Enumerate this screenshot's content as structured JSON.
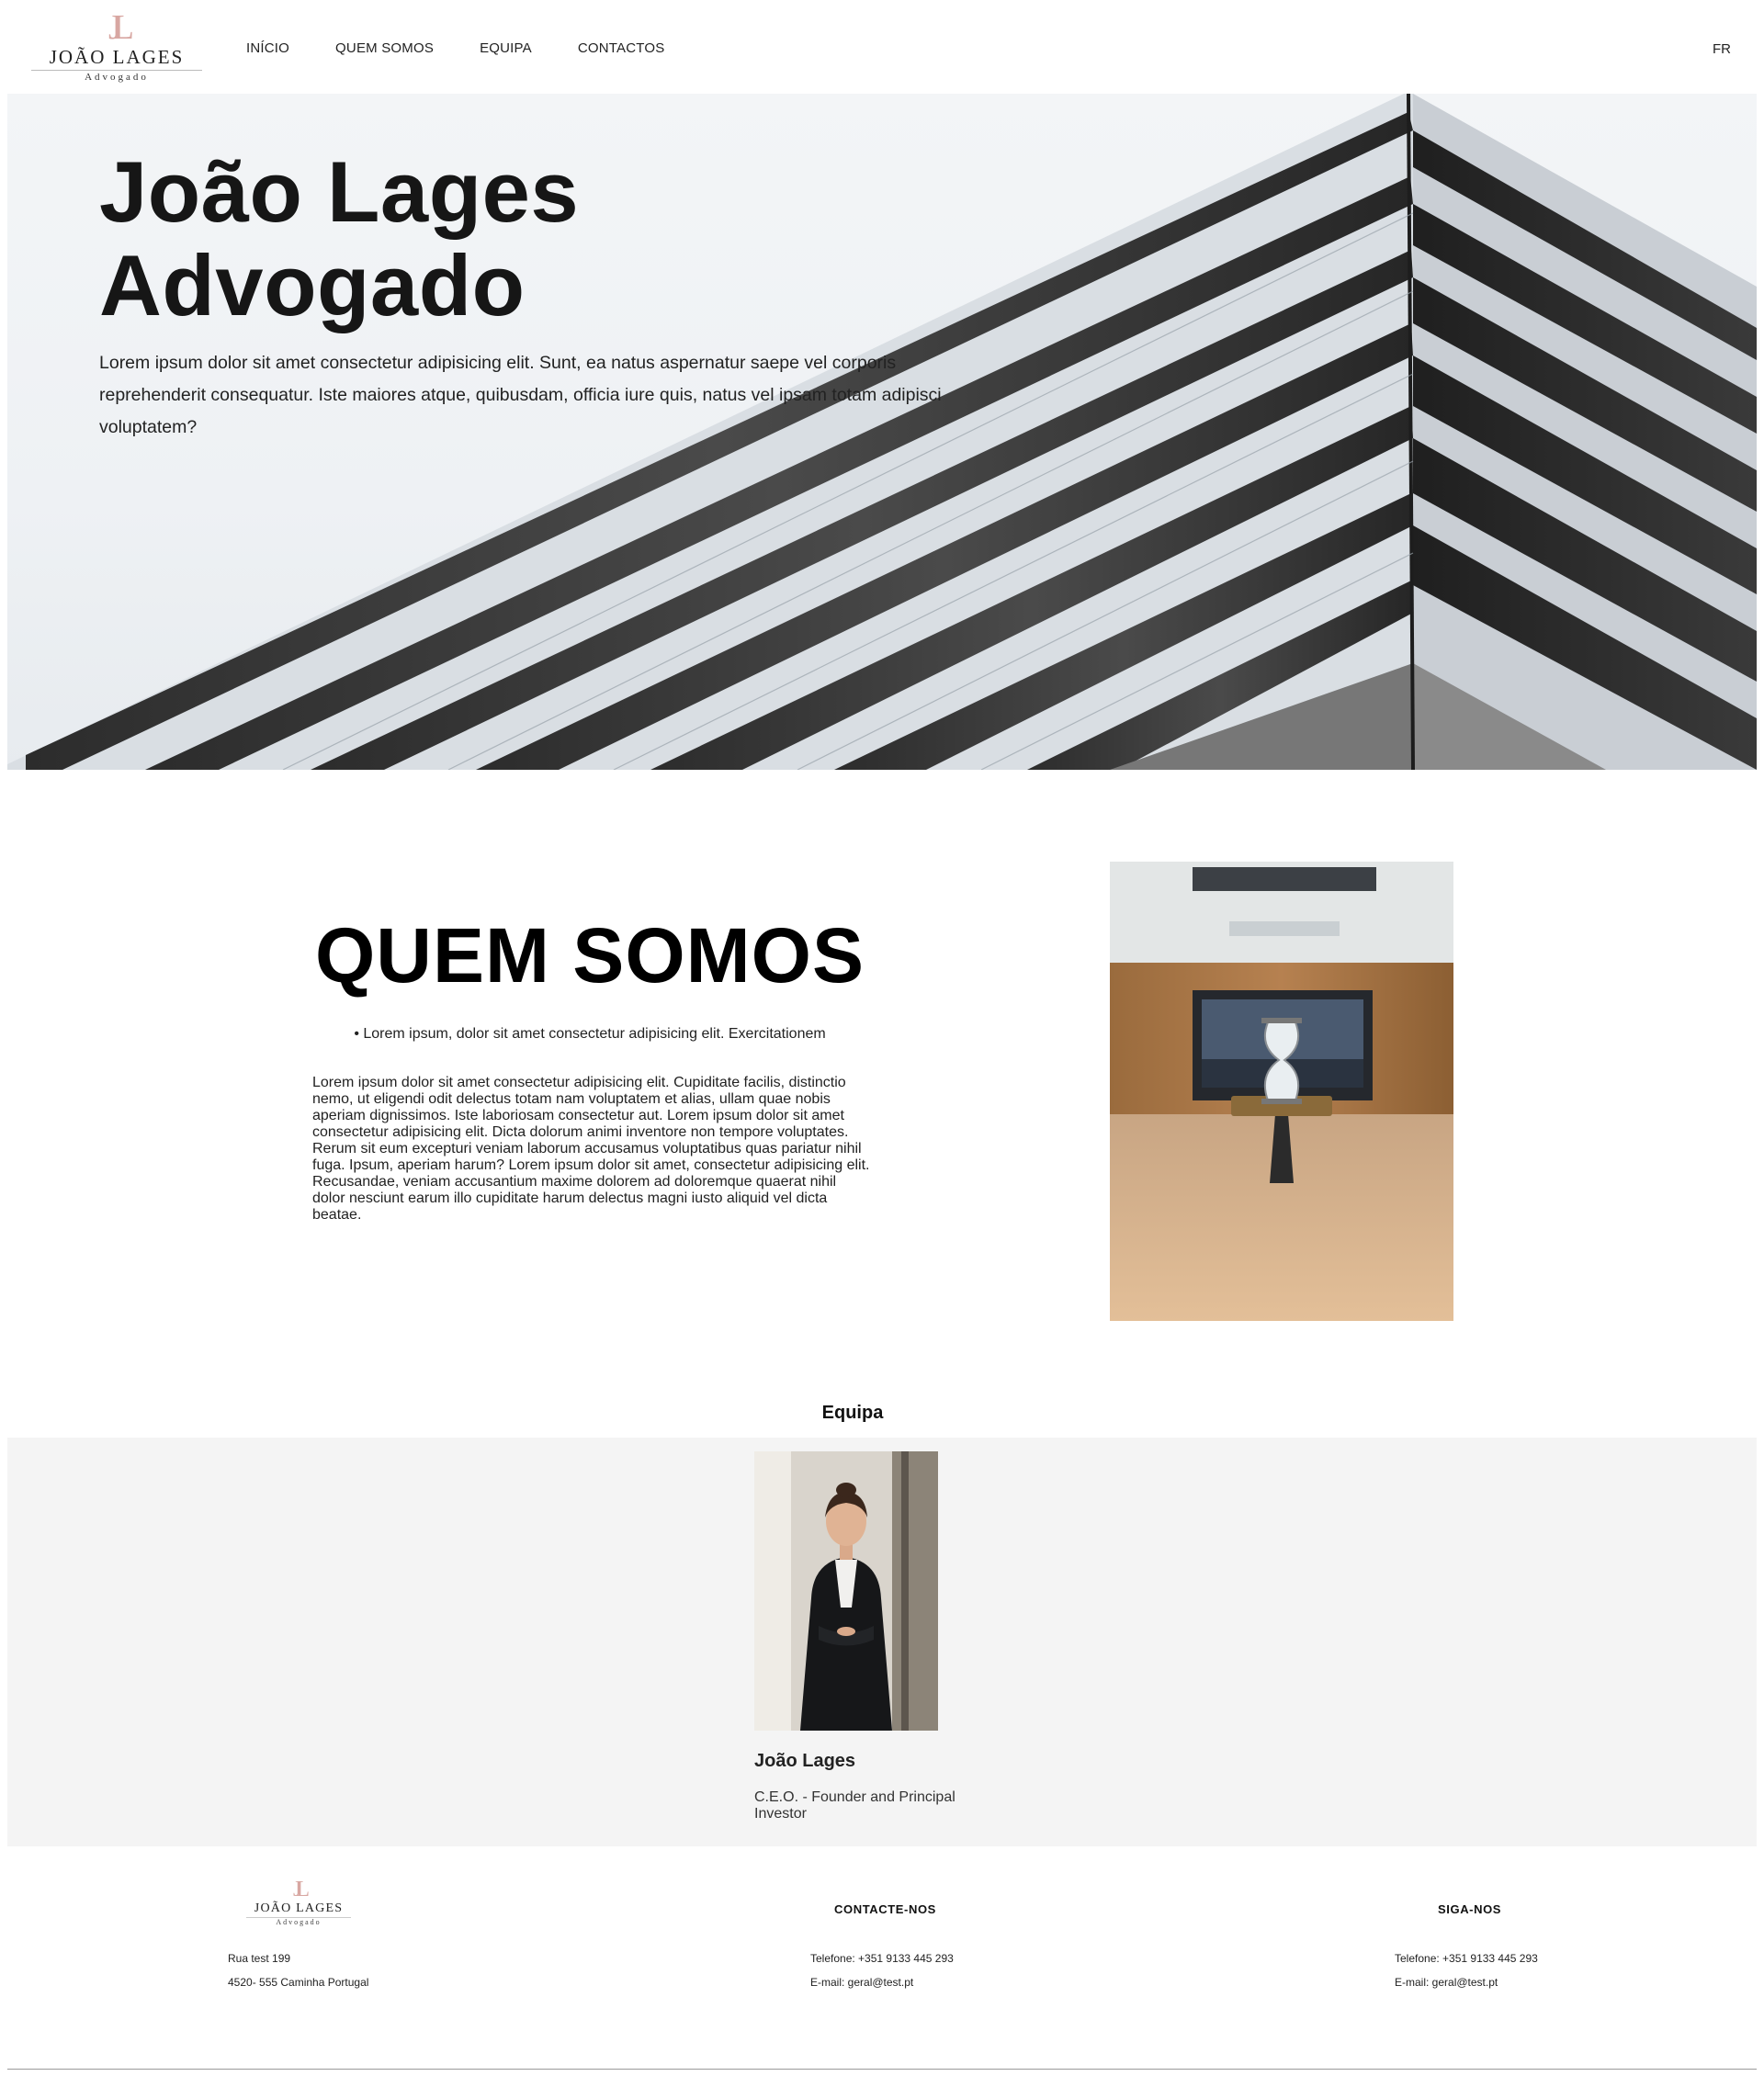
{
  "header": {
    "logo": {
      "monogram": "JL",
      "name": "JOÃO LAGES",
      "subtitle": "Advogado"
    },
    "nav": [
      "INÍCIO",
      "QUEM SOMOS",
      "EQUIPA",
      "CONTACTOS"
    ],
    "language": "FR"
  },
  "hero": {
    "title_line1": "João Lages",
    "title_line2": "Advogado",
    "body": "Lorem ipsum dolor sit amet consectetur adipisicing elit. Sunt, ea natus aspernatur saepe vel corporis reprehenderit consequatur. Iste maiores atque, quibusdam, officia iure quis, natus vel ipsam totam adipisci voluptatem?"
  },
  "about": {
    "title": "QUEM SOMOS",
    "bullet": "Lorem ipsum, dolor sit amet consectetur adipisicing elit. Exercitationem",
    "body": "Lorem ipsum dolor sit amet consectetur adipisicing elit. Cupiditate facilis, distinctio nemo, ut eligendi odit delectus totam nam voluptatem et alias, ullam quae nobis aperiam dignissimos. Iste laboriosam consectetur aut. Lorem ipsum dolor sit amet consectetur adipisicing elit. Dicta dolorum animi inventore non tempore voluptates. Rerum sit eum excepturi veniam laborum accusamus voluptatibus quas pariatur nihil fuga. Ipsum, aperiam harum? Lorem ipsum dolor sit amet, consectetur adipisicing elit. Recusandae, veniam accusantium maxime dolorem ad doloremque quaerat nihil dolor nesciunt earum illo cupiditate harum delectus magni iusto aliquid vel dicta beatae."
  },
  "team": {
    "heading": "Equipa",
    "member": {
      "name": "João Lages",
      "role": "C.E.O. - Founder and Principal Investor"
    }
  },
  "footer": {
    "logo": {
      "monogram": "JL",
      "name": "JOÃO LAGES",
      "subtitle": "Advogado"
    },
    "address": [
      "Rua test 199",
      "4520- 555 Caminha Portugal"
    ],
    "contact": {
      "title": "CONTACTE-NOS",
      "phone": "Telefone: +351 9133 445 293",
      "email": "E-mail: geral@test.pt"
    },
    "follow": {
      "title": "SIGA-NOS",
      "phone": "Telefone: +351 9133 445 293",
      "email": "E-mail: geral@test.pt"
    }
  }
}
